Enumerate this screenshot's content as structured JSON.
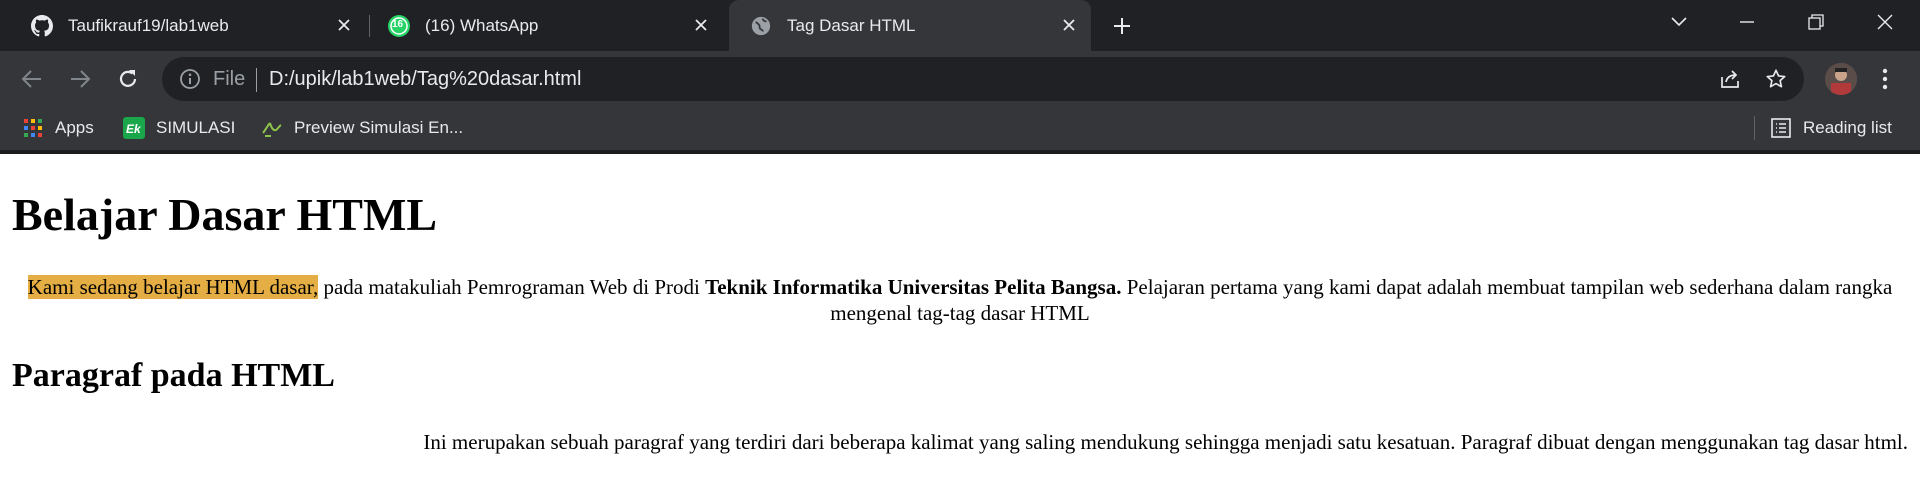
{
  "tabs": [
    {
      "title": "Taufikrauf19/lab1web",
      "icon": "github-icon",
      "active": false
    },
    {
      "title": "(16) WhatsApp",
      "icon": "whatsapp-icon",
      "badge": "16",
      "active": false
    },
    {
      "title": "Tag Dasar HTML",
      "icon": "globe-icon",
      "active": true
    }
  ],
  "toolbar": {
    "file_label": "File",
    "url": "D:/upik/lab1web/Tag%20dasar.html"
  },
  "bookmarks": [
    {
      "label": "Apps",
      "icon": "apps-grid-icon"
    },
    {
      "label": "SIMULASI",
      "icon": "ek-logo-icon"
    },
    {
      "label": "Preview Simulasi En...",
      "icon": "simulasi-preview-icon"
    }
  ],
  "reading_list": "Reading list",
  "colors": {
    "highlight": "#e5ae44",
    "chrome_dark": "#202124",
    "chrome_toolbar": "#35363a"
  },
  "page": {
    "heading": "Belajar Dasar HTML",
    "intro_highlight": "Kami sedang belajar HTML dasar,",
    "intro_text1": " pada matakuliah Pemrograman Web di Prodi ",
    "intro_bold": "Teknik Informatika Universitas Pelita Bangsa.",
    "intro_text2": " Pelajaran pertama yang kami dapat adalah membuat tampilan web sederhana dalam rangka mengenal tag-tag dasar HTML",
    "subheading": "Paragraf pada HTML",
    "paragraph": "Ini merupakan sebuah paragraf yang terdiri dari beberapa kalimat yang saling mendukung sehingga menjadi satu kesatuan. Paragraf dibuat dengan menggunakan tag dasar html."
  }
}
